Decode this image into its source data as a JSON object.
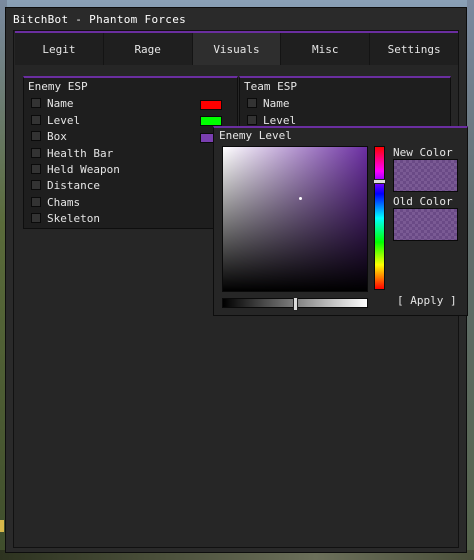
{
  "window": {
    "title": "BitchBot - Phantom Forces"
  },
  "tabs": [
    {
      "label": "Legit",
      "active": false
    },
    {
      "label": "Rage",
      "active": false
    },
    {
      "label": "Visuals",
      "active": true
    },
    {
      "label": "Misc",
      "active": false
    },
    {
      "label": "Settings",
      "active": false
    }
  ],
  "colors": {
    "accent": "#6a2ea0",
    "background": "#262626"
  },
  "enemy_esp": {
    "title": "Enemy ESP",
    "items": [
      {
        "label": "Name",
        "checked": false,
        "swatch": "#ff0000"
      },
      {
        "label": "Level",
        "checked": false,
        "swatch": "#00ff00"
      },
      {
        "label": "Box",
        "checked": false,
        "swatch": "#7a3fb0"
      },
      {
        "label": "Health Bar",
        "checked": false
      },
      {
        "label": "Held Weapon",
        "checked": false
      },
      {
        "label": "Distance",
        "checked": false
      },
      {
        "label": "Chams",
        "checked": false
      },
      {
        "label": "Skeleton",
        "checked": false
      }
    ]
  },
  "team_esp": {
    "title": "Team ESP",
    "items": [
      {
        "label": "Name",
        "checked": false
      },
      {
        "label": "Level",
        "checked": false
      }
    ]
  },
  "color_picker": {
    "title": "Enemy Level",
    "new_color_label": "New Color",
    "old_color_label": "Old Color",
    "apply_label": "[ Apply ]",
    "hue_color": "#6b2ea2",
    "alpha_fraction": 0.5
  }
}
